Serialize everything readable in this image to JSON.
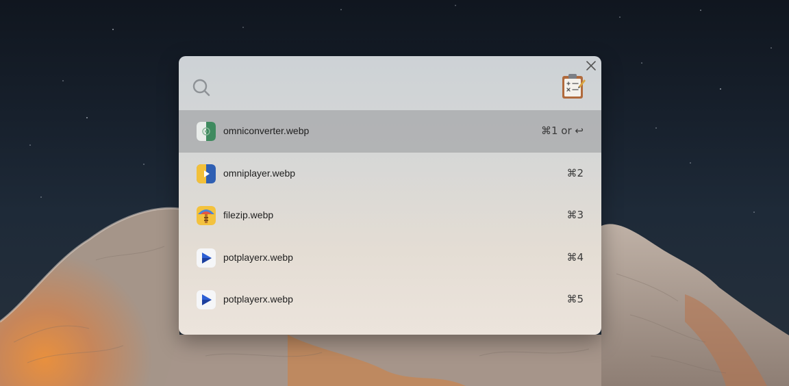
{
  "search": {
    "placeholder": "",
    "value": ""
  },
  "results": [
    {
      "name": "omniconverter.webp",
      "shortcut": "⌘1 or ↩",
      "icon": "omniconverter-app-icon",
      "selected": true
    },
    {
      "name": "omniplayer.webp",
      "shortcut": "⌘2",
      "icon": "omniplayer-app-icon",
      "selected": false
    },
    {
      "name": "filezip.webp",
      "shortcut": "⌘3",
      "icon": "filezip-app-icon",
      "selected": false
    },
    {
      "name": "potplayerx.webp",
      "shortcut": "⌘4",
      "icon": "potplayerx-app-icon",
      "selected": false
    },
    {
      "name": "potplayerx.webp",
      "shortcut": "⌘5",
      "icon": "potplayerx-app-icon",
      "selected": false
    }
  ],
  "icons": {
    "close": "close-icon",
    "search": "search-icon",
    "clipboard": "clipboard-icon"
  },
  "colors": {
    "selected_row": "#9a9c9e",
    "panel_top": "#cdd2d6",
    "panel_bottom": "#ece4dc"
  }
}
